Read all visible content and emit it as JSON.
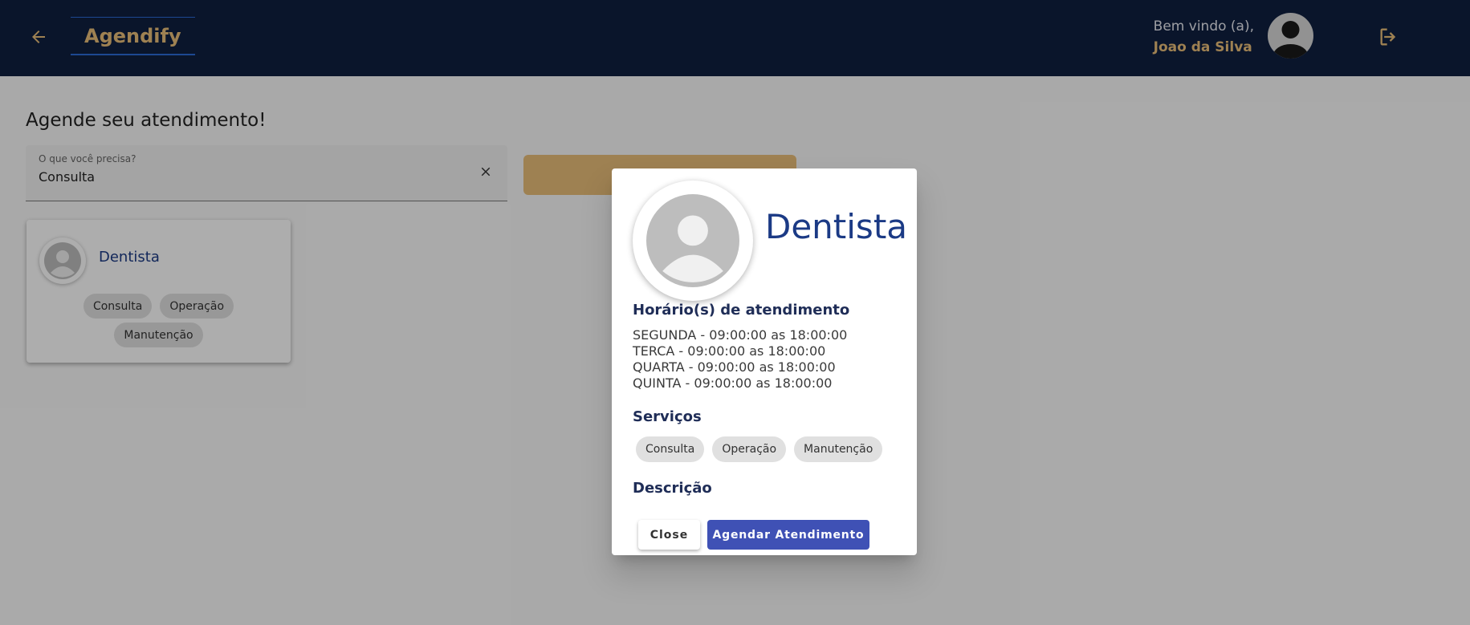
{
  "header": {
    "app_name": "Agendify",
    "welcome_text": "Bem vindo (a),",
    "user_name": "Joao da Silva"
  },
  "main": {
    "title": "Agende seu atendimento!",
    "search": {
      "label": "O que você precisa?",
      "value": "Consulta"
    },
    "results": [
      {
        "name": "Dentista",
        "services": [
          "Consulta",
          "Operação",
          "Manutenção"
        ]
      }
    ]
  },
  "dialog": {
    "title": "Dentista",
    "hours_heading": "Horário(s) de atendimento",
    "hours": [
      "SEGUNDA - 09:00:00 as 18:00:00",
      "TERCA - 09:00:00 as 18:00:00",
      "QUARTA - 09:00:00 as 18:00:00",
      "QUINTA - 09:00:00 as 18:00:00"
    ],
    "services_heading": "Serviços",
    "services": [
      "Consulta",
      "Operação",
      "Manutenção"
    ],
    "description_heading": "Descrição",
    "close_label": "Close",
    "schedule_label": "Agendar Atendimento"
  },
  "colors": {
    "header_bg": "#0f1f40",
    "accent_gold": "#e9be7a",
    "primary_blue": "#3f51b5",
    "title_blue": "#1b3a85"
  }
}
